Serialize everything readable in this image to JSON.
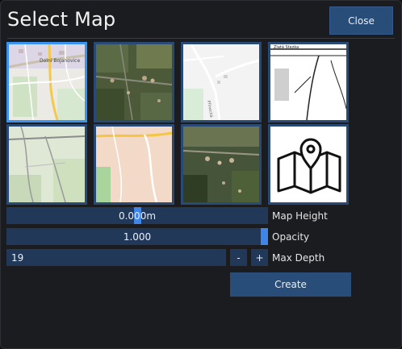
{
  "window": {
    "title": "Select Map",
    "close_label": "Close"
  },
  "maps": [
    {
      "name": "street-map-1",
      "selected": true
    },
    {
      "name": "satellite-map-1",
      "selected": false
    },
    {
      "name": "street-map-2",
      "selected": false
    },
    {
      "name": "topographic-map",
      "selected": false
    },
    {
      "name": "terrain-map",
      "selected": false
    },
    {
      "name": "warm-street-map",
      "selected": false
    },
    {
      "name": "satellite-map-2",
      "selected": false
    },
    {
      "name": "custom-map",
      "selected": false
    }
  ],
  "map_label_texts": {
    "town": "Dolní Bojanovice",
    "street": "Přinecká",
    "road": "Zlatá Stezka"
  },
  "controls": {
    "height": {
      "value": "0.000m",
      "label": "Map Height",
      "fraction": 0.5
    },
    "opacity": {
      "value": "1.000",
      "label": "Opacity",
      "fraction": 1.0
    },
    "depth": {
      "value": "19",
      "label": "Max Depth",
      "minus": "-",
      "plus": "+"
    }
  },
  "create_label": "Create",
  "colors": {
    "accent": "#3a93f0",
    "button": "#284d79",
    "field": "#223859",
    "background": "#1b1c20"
  }
}
